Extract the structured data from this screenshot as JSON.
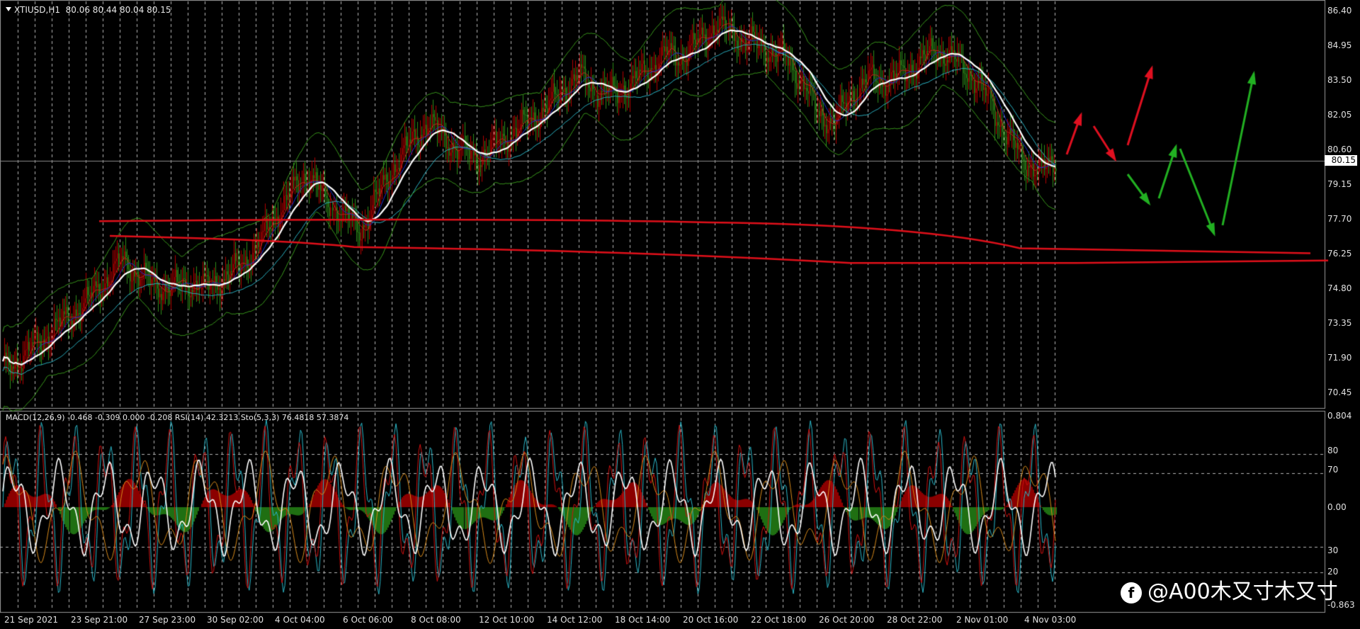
{
  "header": {
    "symbol": "XTIUSD,H1",
    "ohlc": "80.06 80.44 80.04 80.15"
  },
  "indicator_header": "MACD(12,26,9) -0.468 -0.309 0.000 -0.208  RSI(14) 42.3213  Sto(5,3,3) 76.4818 57.3874",
  "price_axis": [
    "86.40",
    "84.95",
    "83.50",
    "82.05",
    "80.60",
    "79.15",
    "77.70",
    "76.25",
    "74.80",
    "73.35",
    "71.90",
    "70.45"
  ],
  "current_price": "80.15",
  "indicator_axis": {
    "top": "0.804",
    "level_80": "80",
    "level_70": "70",
    "zero": "0.00",
    "level_30": "30",
    "level_20": "20",
    "bottom": "-0.863"
  },
  "time_axis": [
    "21 Sep 2021",
    "23 Sep 21:00",
    "27 Sep 23:00",
    "30 Sep 02:00",
    "4 Oct 04:00",
    "6 Oct 06:00",
    "8 Oct 08:00",
    "12 Oct 10:00",
    "14 Oct 12:00",
    "18 Oct 14:00",
    "20 Oct 16:00",
    "22 Oct 18:00",
    "26 Oct 20:00",
    "28 Oct 22:00",
    "2 Nov 01:00",
    "4 Nov 03:00"
  ],
  "watermark": {
    "logo": "f",
    "text": "@A00木又寸木又寸"
  },
  "colors": {
    "background": "#000000",
    "grid": "#c8c8c8",
    "bull_candle": "#b00000",
    "bear_candle": "#2e8b1a",
    "bollinger": "#3a9c1c",
    "ma_white": "#ffffff",
    "ma_cyan": "#2bb7c8",
    "ma_blue": "#1f2fd0",
    "support_lines": "#e0101a",
    "arrow_red": "#e01020",
    "arrow_green": "#22b022",
    "macd_pos": "#8b0000",
    "macd_neg": "#1f6f12",
    "rsi": "#ffffff",
    "stoch_main": "#2bb7c8",
    "stoch_signal": "#d01010"
  },
  "chart_data": {
    "type": "candlestick",
    "symbol": "XTIUSD",
    "timeframe": "H1",
    "ylim": [
      70.0,
      86.6
    ],
    "close_series": [
      71.6,
      72.0,
      72.6,
      73.2,
      73.8,
      74.4,
      75.2,
      76.0,
      75.4,
      75.0,
      74.9,
      75.1,
      74.9,
      75.3,
      75.8,
      76.6,
      77.8,
      78.8,
      79.6,
      78.4,
      77.9,
      77.2,
      78.6,
      79.8,
      80.8,
      81.6,
      81.0,
      80.4,
      80.2,
      80.7,
      81.2,
      81.7,
      82.2,
      83.0,
      83.5,
      82.9,
      82.8,
      83.2,
      83.8,
      84.4,
      84.3,
      84.9,
      85.6,
      85.2,
      84.9,
      84.6,
      84.3,
      83.4,
      82.0,
      81.6,
      82.8,
      83.4,
      83.3,
      83.6,
      84.1,
      84.6,
      84.2,
      83.6,
      82.6,
      81.2,
      80.2,
      79.6,
      80.15
    ],
    "support_lines": [
      {
        "from": "23 Sep 21:00",
        "level": 77.6
      },
      {
        "from": "23 Sep 21:00",
        "level": 76.4
      }
    ],
    "indicators": [
      "MACD(12,26,9)",
      "RSI(14)",
      "Sto(5,3,3)"
    ]
  }
}
